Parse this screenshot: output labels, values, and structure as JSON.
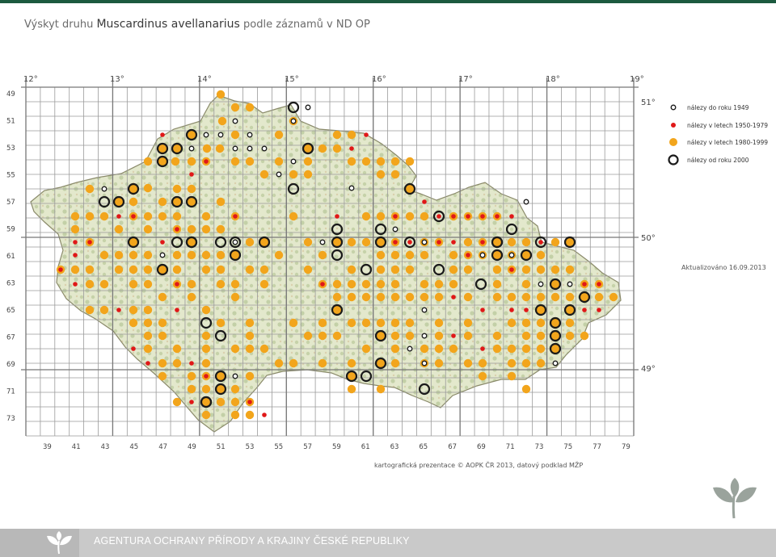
{
  "title": {
    "prefix": "Výskyt druhu",
    "species": "Muscardinus avellanarius",
    "suffix": "podle záznamů v ND OP"
  },
  "map": {
    "longitude_labels": [
      "12°",
      "13°",
      "14°",
      "15°",
      "16°",
      "17°",
      "18°",
      "19°"
    ],
    "latitude_labels": [
      "51°",
      "50°",
      "49°"
    ],
    "row_labels": [
      "49",
      "51",
      "53",
      "55",
      "57",
      "59",
      "61",
      "63",
      "65",
      "67",
      "69",
      "71",
      "73"
    ],
    "column_labels": [
      "39",
      "41",
      "43",
      "45",
      "47",
      "49",
      "51",
      "53",
      "55",
      "57",
      "59",
      "61",
      "63",
      "65",
      "67",
      "69",
      "71",
      "73",
      "75",
      "77",
      "79"
    ],
    "updated": "Aktualizováno 16.09.2013",
    "credit": "kartografická prezentace © AOPK ČR 2013, datový podklad MŽP",
    "legend": [
      {
        "key": "pre1949",
        "label": "nálezy do roku 1949"
      },
      {
        "key": "y1950",
        "label": "nálezy v letech 1950-1979"
      },
      {
        "key": "y1980",
        "label": "nálezy v letech 1980-1999"
      },
      {
        "key": "y2000",
        "label": "nálezy od roku 2000"
      }
    ],
    "colors": {
      "orange": "#f2a51c",
      "red": "#e01818",
      "black_ring": "#1a1a1a",
      "grid": "#9a9a9a",
      "map_fill": "#dfe6c8",
      "brand_green": "#1c5a3f"
    }
  },
  "footer": {
    "organization": "AGENTURA OCHRANY PŘÍRODY A KRAJINY ČESKÉ REPUBLIKY"
  }
}
